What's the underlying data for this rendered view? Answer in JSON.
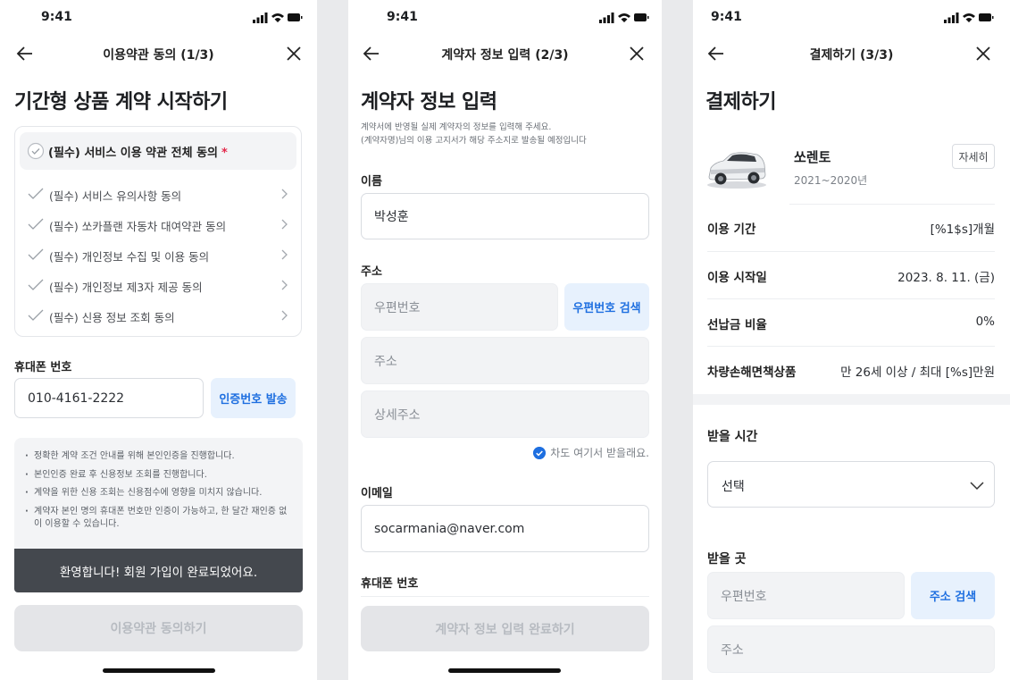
{
  "status": {
    "time": "9:41"
  },
  "screen1": {
    "nav_title": "이용약관 동의 (1/3)",
    "heading": "기간형 상품 계약 시작하기",
    "terms_all": {
      "label": "(필수) 서비스 이용 약관 전체 동의",
      "required_mark": "*"
    },
    "terms": [
      "(필수) 서비스 유의사항 동의",
      "(필수) 쏘카플랜 자동차 대여약관 동의",
      "(필수) 개인정보 수집 및 이용 동의",
      "(필수) 개인정보 제3자 제공 동의",
      "(필수) 신용 정보 조회 동의"
    ],
    "phone_label": "휴대폰 번호",
    "phone_value": "010-4161-2222",
    "send_code_button": "인증번호 발송",
    "notices": [
      "정확한 계약 조건 안내를 위해 본인인증을 진행합니다.",
      "본인인증 완료 후 신용정보 조회를 진행합니다.",
      "계약을 위한 신용 조회는 신용점수에 영향을 미치지 않습니다.",
      "계약자 본인 명의 휴대폰 번호만 인증이 가능하고, 한 달간 재인증 없이 이용할 수 있습니다."
    ],
    "toast": "환영합니다! 회원 가입이 완료되었어요.",
    "cta": "이용약관 동의하기"
  },
  "screen2": {
    "nav_title": "계약자 정보 입력 (2/3)",
    "heading": "계약자 정보 입력",
    "desc_line1": "계약서에 반영될 실제 계약자의 정보를 입력해 주세요.",
    "desc_line2": "(계약자명)님의 이용 고지서가 해당 주소지로 발송될 예정입니다",
    "name_label": "이름",
    "name_value": "박성훈",
    "address_label": "주소",
    "zip_placeholder": "우편번호",
    "zip_search_button": "우편번호 검색",
    "address_placeholder": "주소",
    "detail_address_placeholder": "상세주소",
    "receive_here": "차도 여기서 받을래요.",
    "email_label": "이메일",
    "email_value": "socarmania@naver.com",
    "phone_label": "휴대폰 번호",
    "cta": "계약자 정보 입력 완료하기"
  },
  "screen3": {
    "nav_title": "결제하기 (3/3)",
    "heading": "결제하기",
    "car_name": "쏘렌토",
    "car_year": "2021~2020년",
    "detail_button": "자세히",
    "rows": [
      {
        "key": "이용 기간",
        "value": "[%1$s]개월"
      },
      {
        "key": "이용 시작일",
        "value": "2023. 8. 11. (금)"
      },
      {
        "key": "선납금 비율",
        "value": "0%"
      },
      {
        "key": "차량손해면책상품",
        "value": "만 26세 이상 / 최대 [%s]만원"
      }
    ],
    "receive_time_label": "받을 시간",
    "receive_time_value": "선택",
    "receive_place_label": "받을 곳",
    "zip_placeholder": "우편번호",
    "address_search_button": "주소 검색",
    "address_placeholder": "주소"
  },
  "colors": {
    "accent": "#1e6fe0",
    "required": "#e3274a",
    "toast": "#44484e"
  },
  "icons": [
    "back-arrow-icon",
    "close-icon",
    "check-circle-icon",
    "check-icon",
    "chevron-right-icon",
    "chevron-down-icon",
    "signal-icon",
    "wifi-icon",
    "battery-icon"
  ]
}
